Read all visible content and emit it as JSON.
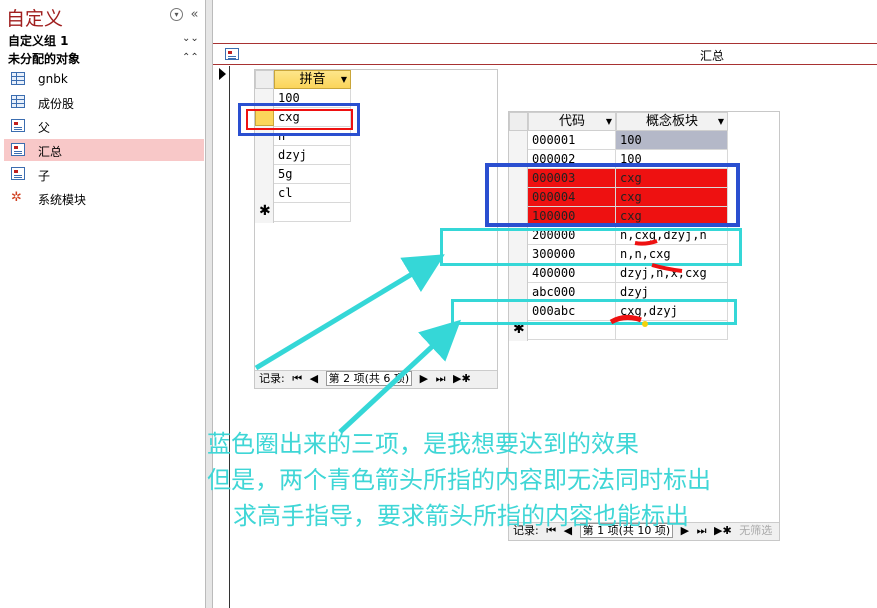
{
  "nav": {
    "title": "自定义",
    "group1": "自定义组 1",
    "group2": "未分配的对象",
    "items": [
      {
        "label": "gnbk",
        "icon": "table-icon"
      },
      {
        "label": "成份股",
        "icon": "table-icon"
      },
      {
        "label": "父",
        "icon": "form-icon"
      },
      {
        "label": "汇总",
        "icon": "form-icon",
        "selected": true
      },
      {
        "label": "子",
        "icon": "form-icon"
      },
      {
        "label": "系统模块",
        "icon": "module-icon"
      }
    ],
    "menu_glyph": "▾",
    "collapse_glyph": "«",
    "chev_down": "¥",
    "chev_up": "^"
  },
  "doc": {
    "title": "汇总"
  },
  "left_sheet": {
    "header": "拼音",
    "rows": [
      "100",
      "cxg",
      "n",
      "dzyj",
      "5g",
      "cl"
    ],
    "navbar": {
      "label": "记录:",
      "first": "⏮",
      "prev": "◀",
      "position": "第 2 项(共 6 项)",
      "next": "▶",
      "last": "⏭",
      "new": "▶✱"
    }
  },
  "right_sheet": {
    "headers": [
      "代码",
      "概念板块"
    ],
    "rows": [
      {
        "code": "000001",
        "concept": "100",
        "highlight": "grey"
      },
      {
        "code": "000002",
        "concept": "100",
        "highlight": ""
      },
      {
        "code": "000003",
        "concept": "cxg",
        "highlight": "red"
      },
      {
        "code": "000004",
        "concept": "cxg",
        "highlight": "red"
      },
      {
        "code": "100000",
        "concept": "cxg",
        "highlight": "red"
      },
      {
        "code": "200000",
        "concept": "n,cxg,dzyj,n",
        "highlight": ""
      },
      {
        "code": "300000",
        "concept": "n,n,cxg",
        "highlight": ""
      },
      {
        "code": "400000",
        "concept": "dzyj,n,x,cxg",
        "highlight": ""
      },
      {
        "code": "abc000",
        "concept": "dzyj",
        "highlight": ""
      },
      {
        "code": "000abc",
        "concept": "cxg,dzyj",
        "highlight": ""
      }
    ],
    "navbar": {
      "label": "记录:",
      "first": "⏮",
      "prev": "◀",
      "position": "第 1 项(共 10 项)",
      "next": "▶",
      "last": "⏭",
      "new": "▶✱",
      "filter": "无筛选"
    }
  },
  "annotations": {
    "line1": "蓝色圈出来的三项，是我想要达到的效果",
    "line2": "但是，两个青色箭头所指的内容即无法同时标出",
    "line3": "求高手指导，要求箭头所指的内容也能标出",
    "blue": "#2a4fd0",
    "cyan": "#35d7d7",
    "red": "#ee1111"
  }
}
